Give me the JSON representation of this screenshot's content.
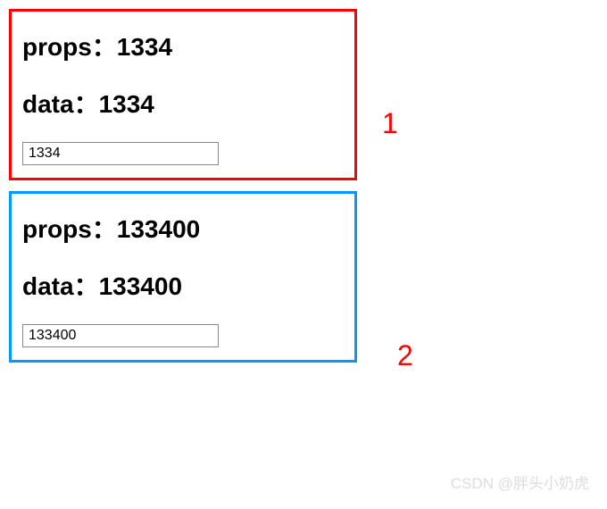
{
  "box1": {
    "props_label": "props：",
    "props_value": "1334",
    "data_label": "data：",
    "data_value": "1334",
    "input_value": "1334",
    "annotation": "1"
  },
  "box2": {
    "props_label": "props：",
    "props_value": "133400",
    "data_label": "data：",
    "data_value": "133400",
    "input_value": "133400",
    "annotation": "2"
  },
  "watermark": "CSDN @胖头小奶虎"
}
